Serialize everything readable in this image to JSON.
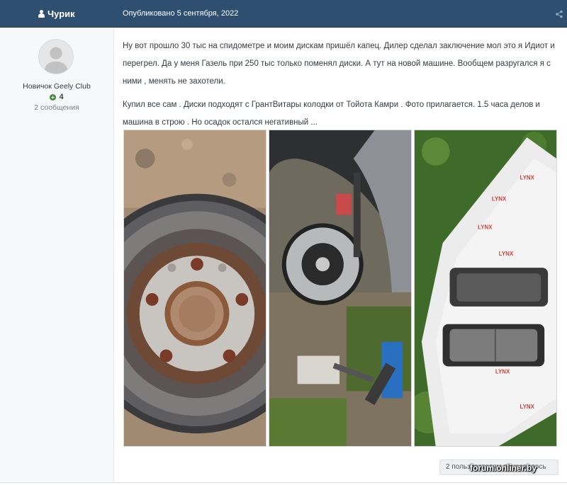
{
  "post": {
    "author": "Чурик",
    "date": "Опубликовано 5 сентября, 2022",
    "paragraphs": [
      "Ну вот прошло 30 тыс на спидометре  и моим дискам пришёл капец.  Дилер сделал заключение мол это я Идиот и перегрел.  Да у меня Газель при 250 тыс только поменял диски. А тут на новой машине. Вообщем разругался я с ними , менять не захотели.",
      "Купил все сам . Диски подходят с ГрантВитары  колодки от Тойота Камри . Фото прилагается. 1.5 часа делов и машина в строю . Но осадок остался негативный ..."
    ],
    "photos": [
      {
        "name": "brake-disc-photo"
      },
      {
        "name": "wheel-hub-photo"
      },
      {
        "name": "brake-pads-photo"
      }
    ],
    "pads_brand": "LYNX",
    "reactions_label": "2 пользователям понравилось"
  },
  "author_pane": {
    "member_group": "Новичок Geely Club",
    "reputation": "4",
    "post_count": "2 сообщения"
  },
  "watermark": "forum.onliner.by",
  "colors": {
    "header": "#2f4f71",
    "text": "#353c41",
    "reputation": "#3a8a3a"
  }
}
